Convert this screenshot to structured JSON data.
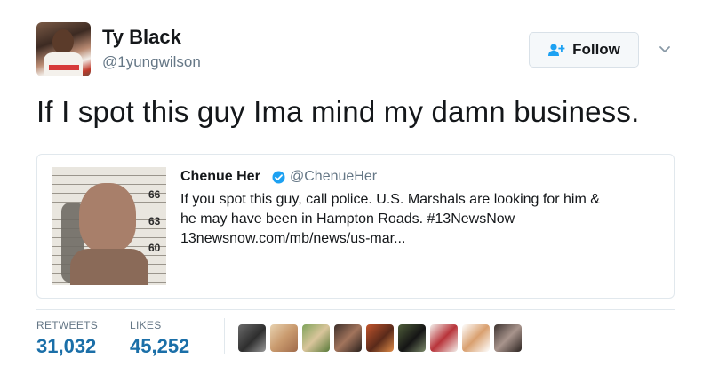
{
  "author": {
    "name": "Ty Black",
    "handle": "@1yungwilson"
  },
  "follow": {
    "label": "Follow"
  },
  "tweet": {
    "text": "If I spot this guy Ima mind my damn business."
  },
  "quoted_tweet": {
    "name": "Chenue Her",
    "handle": "@ChenueHer",
    "verified": true,
    "lines": [
      "If you spot this guy, call police. U.S. Marshals are looking for him &",
      "he may have been in Hampton Roads. #13NewsNow",
      "13newsnow.com/mb/news/us-mar..."
    ],
    "image_height_marks": [
      "66",
      "63",
      "60"
    ]
  },
  "stats": {
    "retweets_label": "RETWEETS",
    "retweets_value": "31,032",
    "likes_label": "LIKES",
    "likes_value": "45,252"
  },
  "colors": {
    "link_blue": "#1b6fa8",
    "verified_blue": "#1da1f2",
    "muted_text": "#657786"
  },
  "icons": {
    "follow": "add-person-icon",
    "more": "chevron-down-icon",
    "verified": "verified-badge-icon"
  }
}
